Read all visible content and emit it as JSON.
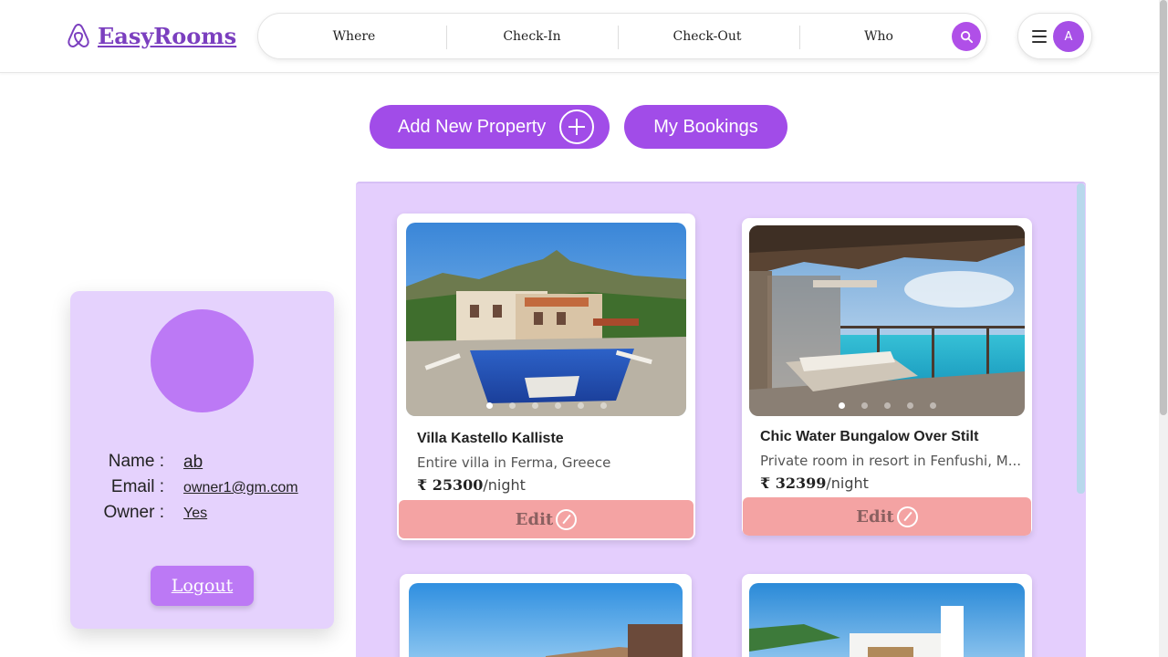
{
  "brand": {
    "name": "EasyRooms"
  },
  "search": {
    "where": "Where",
    "check_in": "Check-In",
    "check_out": "Check-Out",
    "who": "Who"
  },
  "user": {
    "initial": "A"
  },
  "actions": {
    "add_property": "Add New Property",
    "my_bookings": "My Bookings"
  },
  "profile": {
    "name_label": "Name :",
    "name": "ab",
    "email_label": "Email :",
    "email": "owner1@gm.com",
    "owner_label": "Owner :",
    "owner": "Yes",
    "logout": "Logout"
  },
  "listings": [
    {
      "title": "Villa Kastello Kalliste",
      "subtitle": "Entire villa in Ferma, Greece",
      "price": "₹ 25300",
      "per": "/night",
      "edit": "Edit"
    },
    {
      "title": "Chic Water Bungalow Over Stilt",
      "subtitle": "Private room in resort in Fenfushi, M...",
      "price": "₹ 32399",
      "per": "/night",
      "edit": "Edit"
    }
  ],
  "colors": {
    "accent": "#a14ce8",
    "panel": "#e4cefd",
    "edit": "#f4a3a3"
  }
}
